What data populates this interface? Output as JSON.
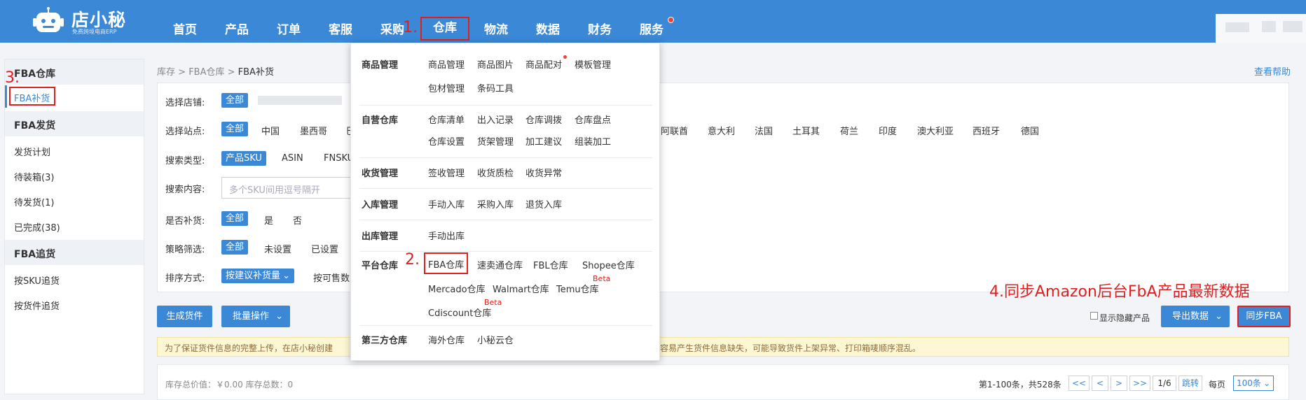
{
  "logo": {
    "name": "店小秘",
    "sub": "免费跨境电商ERP"
  },
  "nav": {
    "items": [
      "首页",
      "产品",
      "订单",
      "客服",
      "采购",
      "仓库",
      "物流",
      "数据",
      "财务",
      "服务"
    ],
    "active": "仓库"
  },
  "annotations": {
    "a1": "1.",
    "a2": "2.",
    "a3": "3.",
    "a4": "4.同步Amazon后台FbA产品最新数据"
  },
  "sidebar": {
    "groups": [
      {
        "title": "FBA仓库",
        "items": [
          "FBA补货"
        ]
      },
      {
        "title": "FBA发货",
        "items": [
          "发货计划",
          "待装箱(3)",
          "待发货(1)",
          "已完成(38)"
        ]
      },
      {
        "title": "FBA追货",
        "items": [
          "按SKU追货",
          "按货件追货"
        ]
      }
    ]
  },
  "breadcrumb": {
    "p1": "库存",
    "p2": "FBA仓库",
    "current": "FBA补货",
    "sep": " > "
  },
  "help": "查看帮助",
  "filters": {
    "shop": {
      "label": "选择店铺:",
      "all": "全部"
    },
    "site": {
      "label": "选择站点:",
      "all": "全部",
      "options": [
        "中国",
        "墨西哥",
        "巳",
        "阿联酋",
        "意大利",
        "法国",
        "土耳其",
        "荷兰",
        "印度",
        "澳大利亚",
        "西班牙",
        "德国"
      ]
    },
    "search_type": {
      "label": "搜索类型:",
      "selected": "产品SKU",
      "options": [
        "ASIN",
        "FNSKU"
      ]
    },
    "search_content": {
      "label": "搜索内容:",
      "placeholder": "多个SKU间用逗号隔开"
    },
    "replenish": {
      "label": "是否补货:",
      "all": "全部",
      "options": [
        "是",
        "否"
      ]
    },
    "strategy": {
      "label": "策略筛选:",
      "all": "全部",
      "options": [
        "未设置",
        "已设置"
      ]
    },
    "sort": {
      "label": "排序方式:",
      "selected": "按建议补货量",
      "next": "按可售数"
    }
  },
  "actions": {
    "generate": "生成货件",
    "batch": "批量操作",
    "show_hidden": "显示隐藏产品",
    "export": "导出数据",
    "sync": "同步FBA"
  },
  "notice_left": "为了保证货件信息的完整上传，在店小秘创建",
  "notice_right": "容易产生货件信息缺失，可能导致货件上架异常、打印箱唛顺序混乱。",
  "footer": {
    "summary": "库存总价值：￥0.00 库存总数：0",
    "count": "第1-100条，共528条",
    "first": "<<",
    "prev": "<",
    "next": ">",
    "last": ">>",
    "page": "1/6",
    "jump": "跳转",
    "per_page_label": "每页",
    "per_page": "100条"
  },
  "dropdown": {
    "sections": [
      {
        "title": "商品管理",
        "links": [
          "商品管理",
          "商品图片",
          "商品配对",
          "模板管理",
          "包材管理",
          "条码工具"
        ]
      },
      {
        "title": "自营仓库",
        "links": [
          "仓库清单",
          "出入记录",
          "仓库调拨",
          "仓库盘点",
          "仓库设置",
          "货架管理",
          "加工建议",
          "组装加工"
        ]
      },
      {
        "title": "收货管理",
        "links": [
          "签收管理",
          "收货质检",
          "收货异常"
        ]
      },
      {
        "title": "入库管理",
        "links": [
          "手动入库",
          "采购入库",
          "退货入库"
        ]
      },
      {
        "title": "出库管理",
        "links": [
          "手动出库"
        ]
      },
      {
        "title": "平台仓库",
        "links": [
          "FBA仓库",
          "速卖通仓库",
          "FBL仓库",
          "Shopee仓库",
          "Mercado仓库",
          "Walmart仓库",
          "Temu仓库",
          "Cdiscount仓库"
        ]
      },
      {
        "title": "第三方仓库",
        "links": [
          "海外仓库",
          "小秘云仓"
        ]
      }
    ],
    "beta": "Beta"
  },
  "colors": {
    "primary": "#3a88d6",
    "highlight": "#e02020"
  }
}
